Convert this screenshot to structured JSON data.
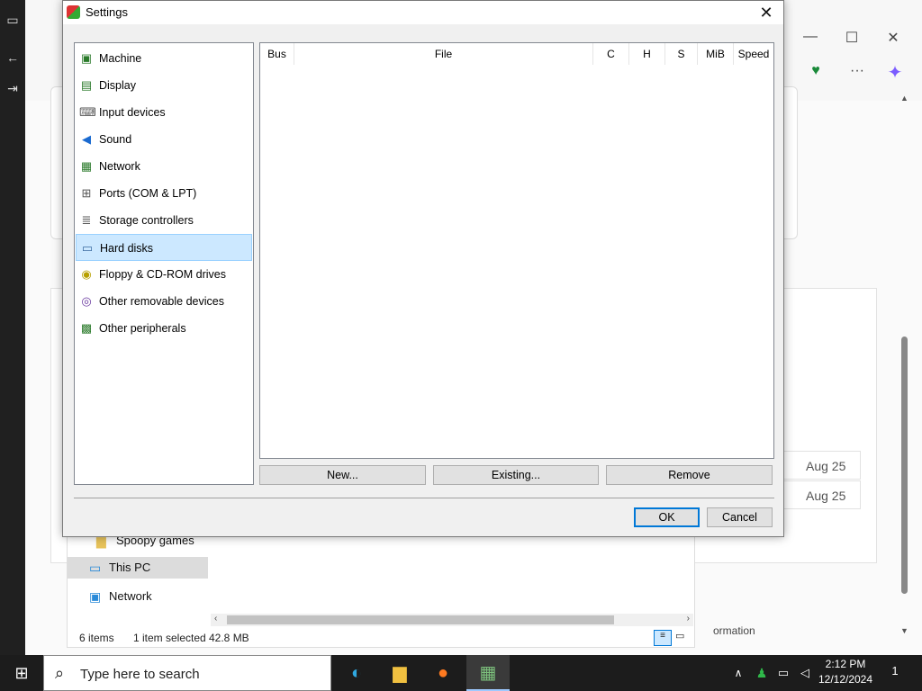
{
  "dialog": {
    "title": "Settings",
    "close_glyph": "✕",
    "categories": [
      {
        "label": "Machine",
        "icon": "machine-icon",
        "glyph": "▣",
        "color": "#2a7a2a"
      },
      {
        "label": "Display",
        "icon": "display-icon",
        "glyph": "▤",
        "color": "#2a7a2a"
      },
      {
        "label": "Input devices",
        "icon": "input-devices-icon",
        "glyph": "⌨",
        "color": "#555"
      },
      {
        "label": "Sound",
        "icon": "sound-icon",
        "glyph": "◀",
        "color": "#1a6ad0"
      },
      {
        "label": "Network",
        "icon": "network-icon",
        "glyph": "▦",
        "color": "#2a7a2a"
      },
      {
        "label": "Ports (COM & LPT)",
        "icon": "ports-icon",
        "glyph": "⊞",
        "color": "#555"
      },
      {
        "label": "Storage controllers",
        "icon": "storage-controllers-icon",
        "glyph": "≣",
        "color": "#555"
      },
      {
        "label": "Hard disks",
        "icon": "hard-disks-icon",
        "glyph": "▭",
        "color": "#3a6aa0"
      },
      {
        "label": "Floppy & CD-ROM drives",
        "icon": "floppy-cdrom-icon",
        "glyph": "◉",
        "color": "#b8a000"
      },
      {
        "label": "Other removable devices",
        "icon": "removable-devices-icon",
        "glyph": "◎",
        "color": "#6a3aa0"
      },
      {
        "label": "Other peripherals",
        "icon": "peripherals-icon",
        "glyph": "▩",
        "color": "#2a7a2a"
      }
    ],
    "selected_category": "Hard disks",
    "columns": {
      "bus": "Bus",
      "file": "File",
      "c": "C",
      "h": "H",
      "s": "S",
      "mib": "MiB",
      "speed": "Speed"
    },
    "buttons": {
      "new": "New...",
      "existing": "Existing...",
      "remove": "Remove",
      "ok": "OK",
      "cancel": "Cancel"
    }
  },
  "background": {
    "dates": [
      "Aug 25",
      "Aug 25"
    ],
    "explorer": {
      "nav": [
        "Spoopy games",
        "This PC",
        "Network"
      ],
      "status_items": "6 items",
      "status_selected": "1 item selected",
      "status_size": "42.8 MB"
    },
    "info_text": "ormation"
  },
  "taskbar": {
    "search_placeholder": "Type here to search",
    "time": "2:12 PM",
    "date": "12/12/2024",
    "notification_count": "1"
  }
}
